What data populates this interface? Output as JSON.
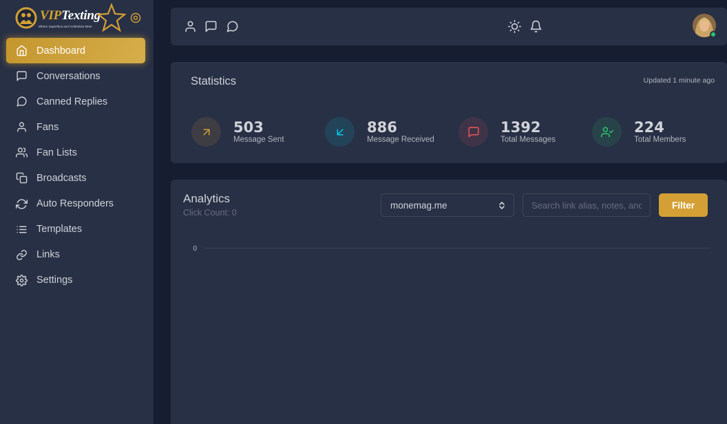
{
  "brand": {
    "name_vip": "VIP",
    "name_rest": "Texting",
    "tagline": "Where Superfans and Celebrities Meet"
  },
  "sidebar": {
    "items": [
      {
        "label": "Dashboard",
        "icon": "home-icon",
        "active": true
      },
      {
        "label": "Conversations",
        "icon": "message-square-icon"
      },
      {
        "label": "Canned Replies",
        "icon": "message-circle-icon"
      },
      {
        "label": "Fans",
        "icon": "user-icon"
      },
      {
        "label": "Fan Lists",
        "icon": "users-icon"
      },
      {
        "label": "Broadcasts",
        "icon": "copy-icon"
      },
      {
        "label": "Auto Responders",
        "icon": "refresh-icon"
      },
      {
        "label": "Templates",
        "icon": "list-icon"
      },
      {
        "label": "Links",
        "icon": "link-icon"
      },
      {
        "label": "Settings",
        "icon": "settings-icon"
      }
    ]
  },
  "navbar": {
    "left_icons": [
      "user-icon",
      "message-square-icon",
      "message-circle-icon"
    ],
    "right_icons": [
      "sun-icon",
      "bell-icon"
    ],
    "user_status": "online"
  },
  "statistics": {
    "title": "Statistics",
    "updated": "Updated 1 minute ago",
    "items": [
      {
        "value": "503",
        "label": "Message Sent",
        "icon": "arrow-up-right-icon",
        "color": "#d4a035"
      },
      {
        "value": "886",
        "label": "Message Received",
        "icon": "arrow-down-left-icon",
        "color": "#00cfe8"
      },
      {
        "value": "1392",
        "label": "Total Messages",
        "icon": "message-square-icon",
        "color": "#ea5455"
      },
      {
        "value": "224",
        "label": "Total Members",
        "icon": "user-check-icon",
        "color": "#28c76f"
      }
    ]
  },
  "analytics": {
    "title": "Analytics",
    "subtitle": "Click Count: 0",
    "domain_select": "monemag.me",
    "search_placeholder": "Search link alias, notes, and more",
    "filter_label": "Filter"
  },
  "chart_data": {
    "type": "line",
    "y_ticks": [
      "0"
    ],
    "series": []
  },
  "colors": {
    "accent": "#d4a035",
    "background": "#161d31",
    "card": "#283046"
  }
}
